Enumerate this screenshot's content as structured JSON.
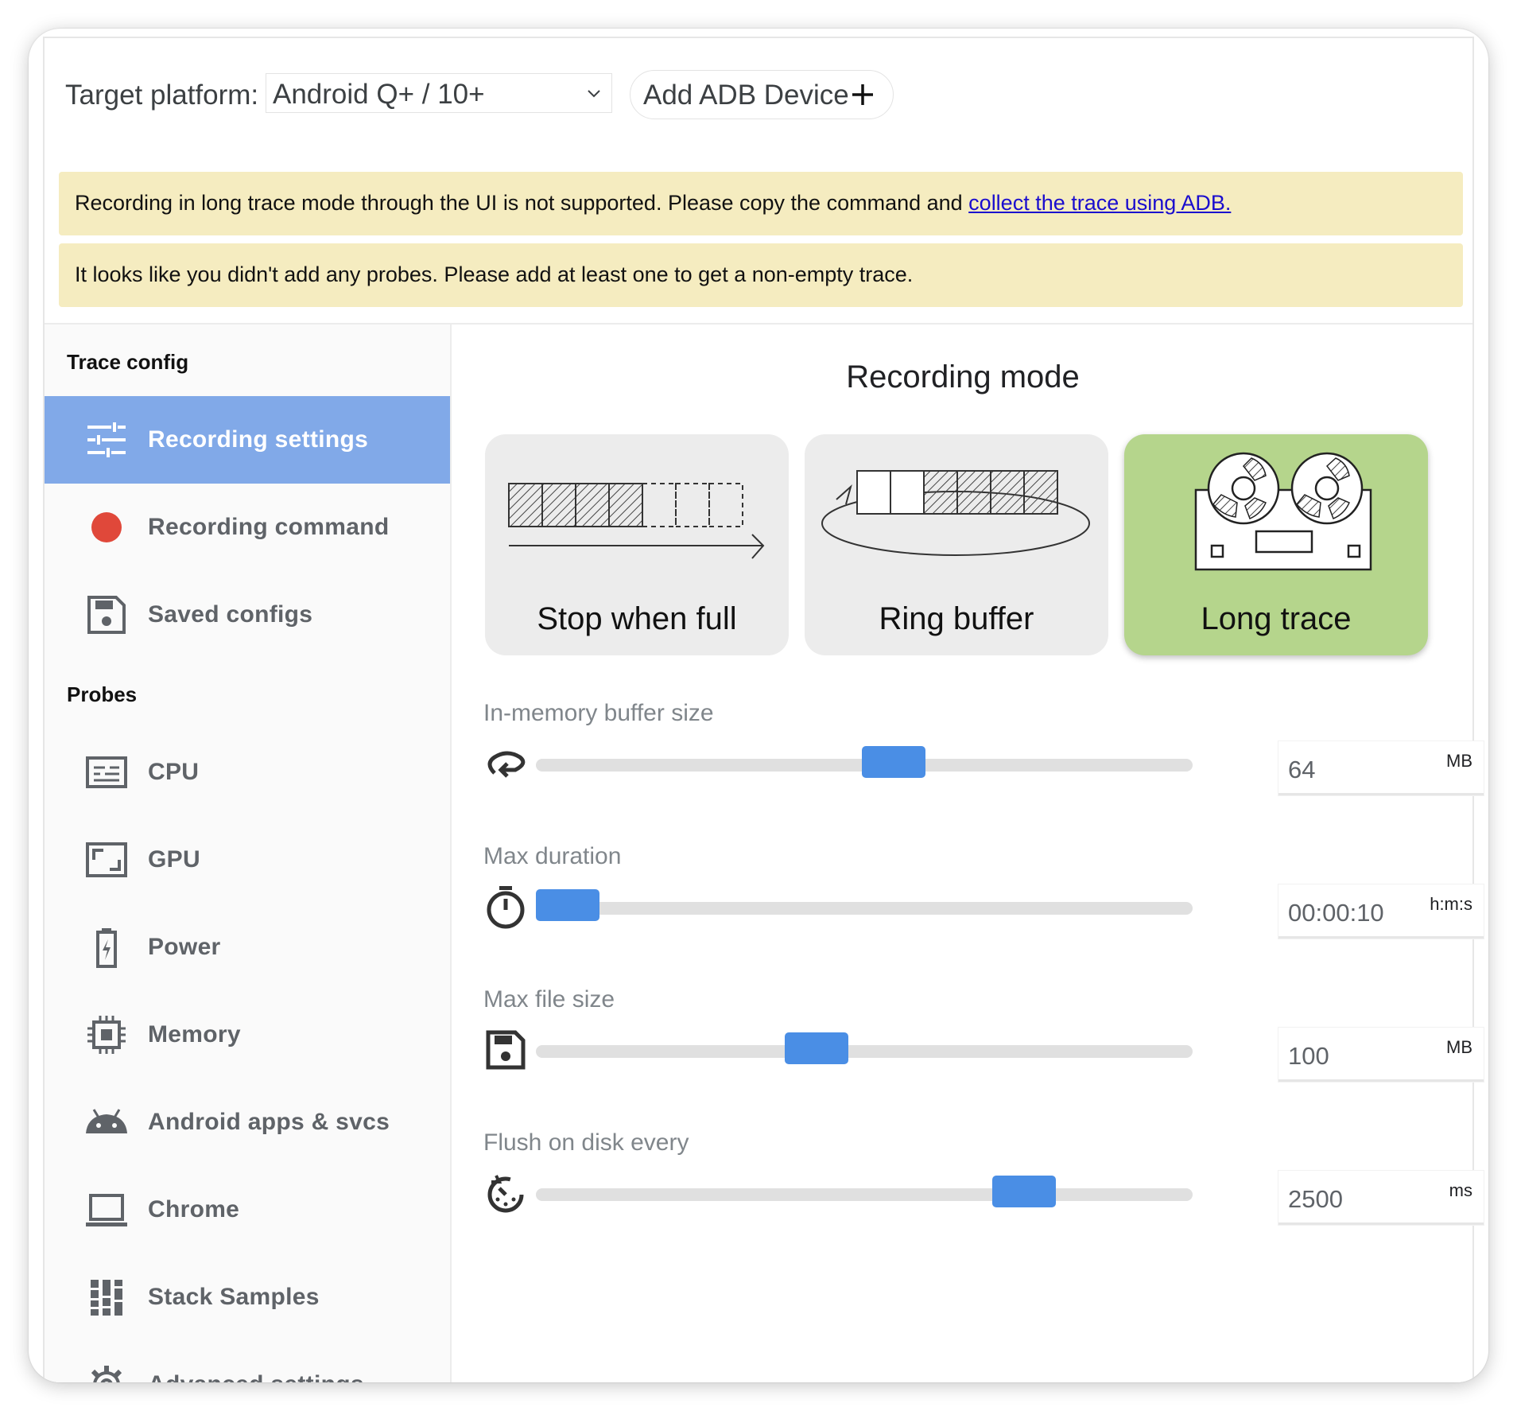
{
  "header": {
    "target_label": "Target platform:",
    "platform_value": "Android Q+ / 10+",
    "add_device_label": "Add ADB Device"
  },
  "banners": {
    "long_trace_text": "Recording in long trace mode through the UI is not supported. Please copy the command and ",
    "long_trace_link": "collect the trace using ADB.",
    "no_probes_text": "It looks like you didn't add any probes. Please add at least one to get a non-empty trace."
  },
  "sidebar": {
    "trace_config_title": "Trace config",
    "probes_title": "Probes",
    "config_items": [
      {
        "label": "Recording settings",
        "icon": "tune-icon",
        "active": true
      },
      {
        "label": "Recording command",
        "icon": "record-dot-icon",
        "active": false
      },
      {
        "label": "Saved configs",
        "icon": "save-icon",
        "active": false
      }
    ],
    "probe_items": [
      {
        "label": "CPU",
        "icon": "cpu-icon"
      },
      {
        "label": "GPU",
        "icon": "gpu-icon"
      },
      {
        "label": "Power",
        "icon": "battery-icon"
      },
      {
        "label": "Memory",
        "icon": "memory-chip-icon"
      },
      {
        "label": "Android apps & svcs",
        "icon": "android-icon"
      },
      {
        "label": "Chrome",
        "icon": "laptop-icon"
      },
      {
        "label": "Stack Samples",
        "icon": "stack-samples-icon"
      },
      {
        "label": "Advanced settings",
        "icon": "gear-icon"
      }
    ]
  },
  "main": {
    "mode_title": "Recording mode",
    "modes": [
      {
        "label": "Stop when full",
        "selected": false
      },
      {
        "label": "Ring buffer",
        "selected": false
      },
      {
        "label": "Long trace",
        "selected": true
      }
    ],
    "settings": [
      {
        "label": "In-memory buffer size",
        "value": "64",
        "unit": "MB",
        "icon": "loop-icon",
        "slider_fraction": 0.55
      },
      {
        "label": "Max duration",
        "value": "00:00:10",
        "unit": "h:m:s",
        "icon": "timer-icon",
        "slider_fraction": 0.0
      },
      {
        "label": "Max file size",
        "value": "100",
        "unit": "MB",
        "icon": "save-icon",
        "slider_fraction": 0.42
      },
      {
        "label": "Flush on disk every",
        "value": "2500",
        "unit": "ms",
        "icon": "flush-timer-icon",
        "slider_fraction": 0.77
      }
    ]
  },
  "colors": {
    "active_nav": "#81a9e8",
    "banner": "#f5ecc0",
    "slider_thumb": "#4a8ee5",
    "selected_mode": "#b5d58c",
    "record_dot": "#e0483a"
  }
}
